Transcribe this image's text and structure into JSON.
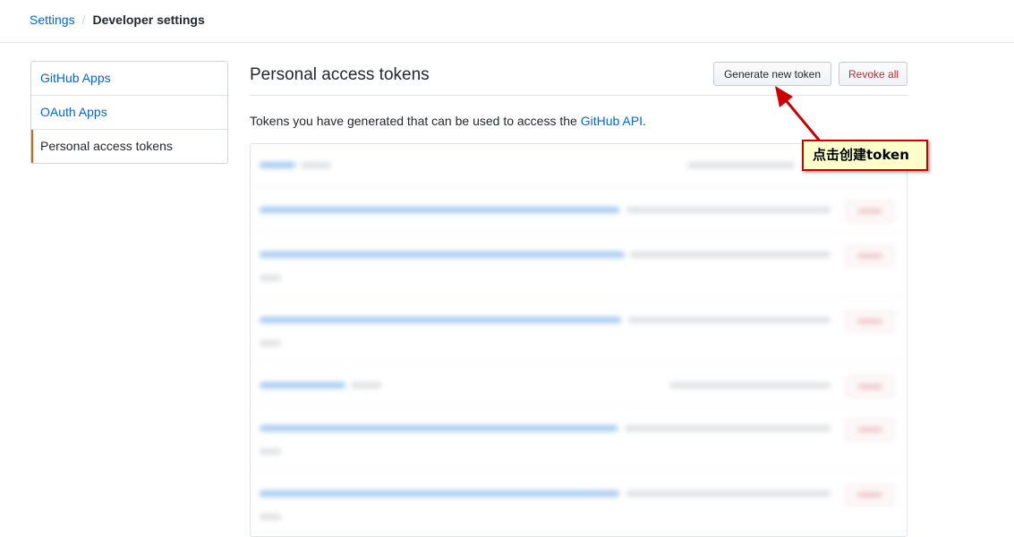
{
  "breadcrumb": {
    "root": "Settings",
    "separator": "/",
    "current": "Developer settings"
  },
  "sidebar": {
    "items": [
      {
        "label": "GitHub Apps",
        "selected": false
      },
      {
        "label": "OAuth Apps",
        "selected": false
      },
      {
        "label": "Personal access tokens",
        "selected": true
      }
    ]
  },
  "main": {
    "title": "Personal access tokens",
    "generate_label": "Generate new token",
    "revoke_label": "Revoke all",
    "description_prefix": "Tokens you have generated that can be used to access the ",
    "description_link": "GitHub API",
    "description_suffix": "."
  },
  "annotation": {
    "text": "点击创建token",
    "border_color": "#cc0000",
    "background": "#ffffcc"
  },
  "colors": {
    "link": "#0366d6",
    "accent": "#e36209",
    "danger": "#cb2431"
  }
}
